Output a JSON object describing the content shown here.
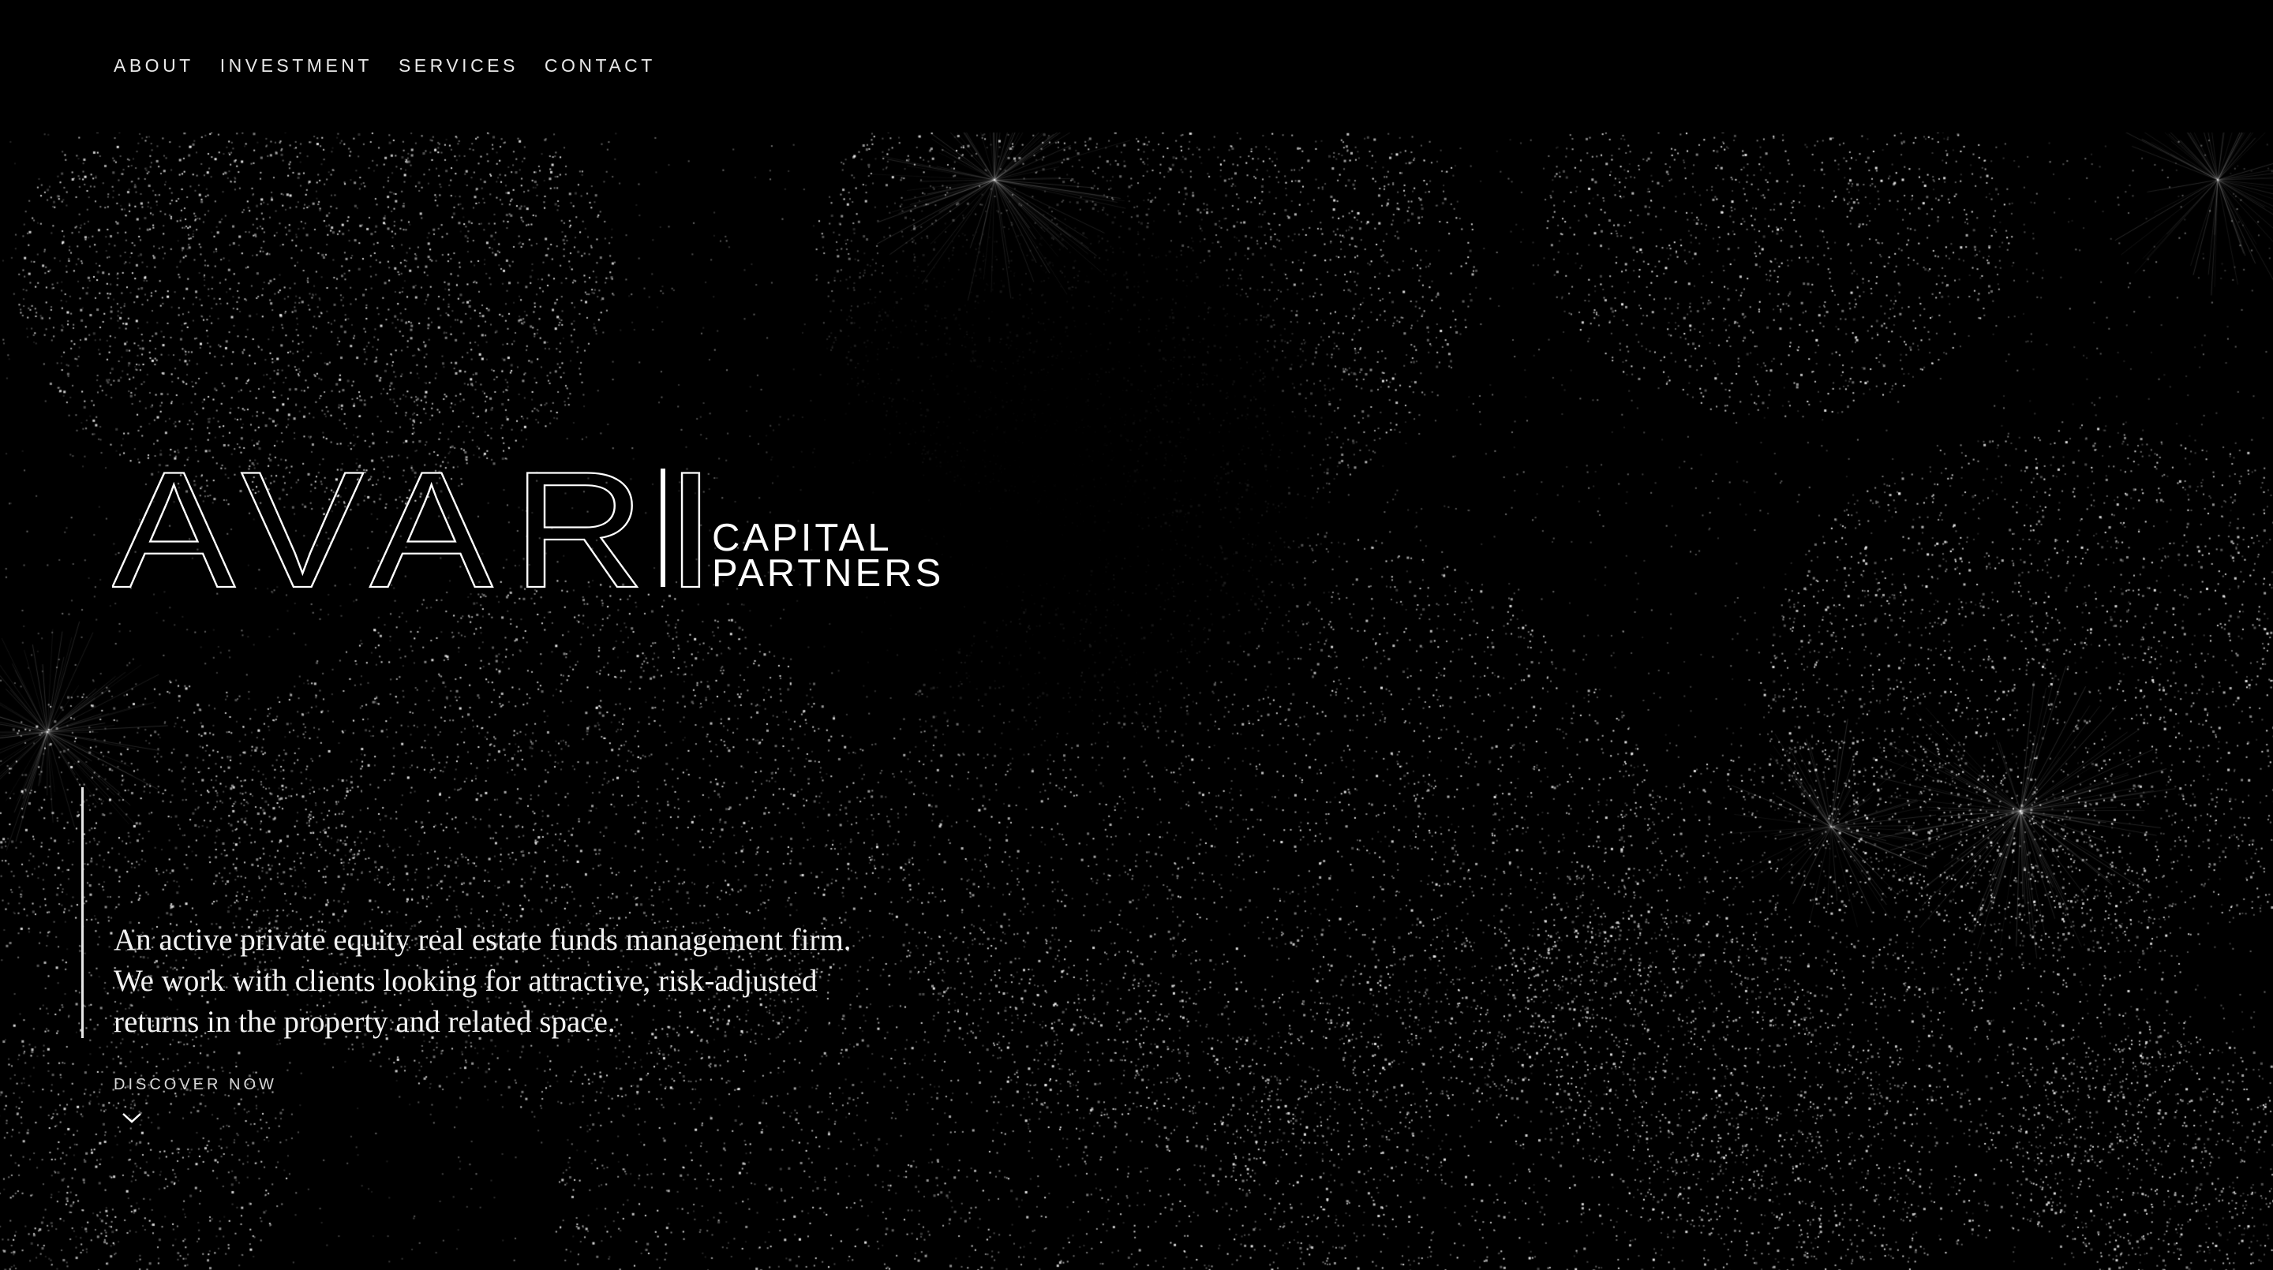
{
  "nav": {
    "items": [
      {
        "label": "ABOUT"
      },
      {
        "label": "INVESTMENT"
      },
      {
        "label": "SERVICES"
      },
      {
        "label": "CONTACT"
      }
    ]
  },
  "logo": {
    "wordmark": "AVARI",
    "line1": "CAPITAL",
    "line2": "PARTNERS"
  },
  "hero": {
    "tagline": [
      "An active private equity real estate funds management firm.",
      "We work with clients looking for attractive, risk-adjusted",
      "returns in the property and related space."
    ],
    "cta_label": "DISCOVER NOW",
    "cta_icon": "chevron-down-icon"
  },
  "colors": {
    "background": "#000000",
    "text": "#ffffff",
    "particles": "#ffffff"
  }
}
